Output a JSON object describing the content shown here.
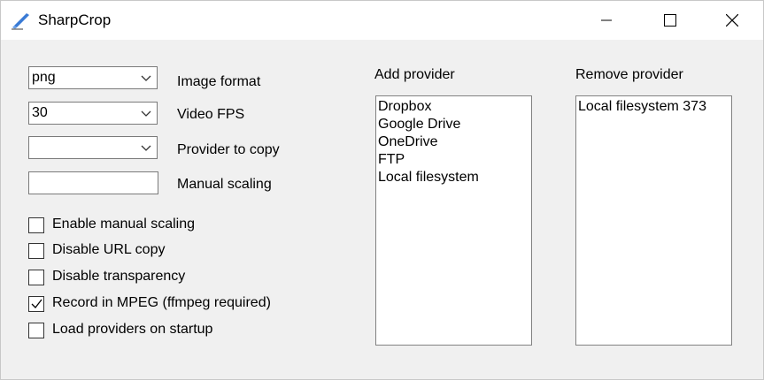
{
  "window": {
    "title": "SharpCrop"
  },
  "fields": {
    "image_format": {
      "value": "png",
      "label": "Image format"
    },
    "video_fps": {
      "value": "30",
      "label": "Video FPS"
    },
    "provider_to_copy": {
      "value": "",
      "label": "Provider to copy"
    },
    "manual_scaling": {
      "value": "",
      "label": "Manual scaling"
    }
  },
  "checkboxes": [
    {
      "label": "Enable manual scaling",
      "checked": false
    },
    {
      "label": "Disable URL copy",
      "checked": false
    },
    {
      "label": "Disable transparency",
      "checked": false
    },
    {
      "label": "Record in MPEG (ffmpeg required)",
      "checked": true
    },
    {
      "label": "Load providers on startup",
      "checked": false
    }
  ],
  "add_provider": {
    "label": "Add provider",
    "items": [
      "Dropbox",
      "Google Drive",
      "OneDrive",
      "FTP",
      "Local filesystem"
    ]
  },
  "remove_provider": {
    "label": "Remove provider",
    "items": [
      "Local filesystem 373"
    ]
  }
}
